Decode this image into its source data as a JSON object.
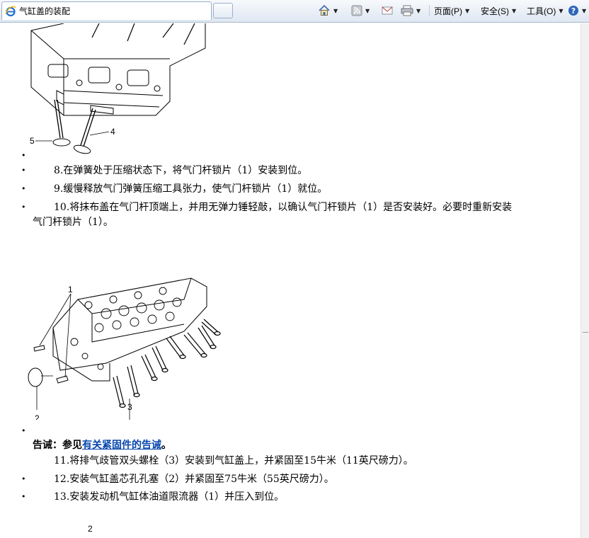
{
  "browser": {
    "tab_title": "气缸盖的装配",
    "commands": {
      "page_label": "页面(P)",
      "safety_label": "安全(S)",
      "tools_label": "工具(O)"
    }
  },
  "figure_top": {
    "callouts": [
      "5",
      "4"
    ]
  },
  "steps_a": [
    {
      "text": "8.在弹簧处于压缩状态下，将气门杆锁片（1）安装到位。"
    },
    {
      "text": "9.缓慢释放气门弹簧压缩工具张力，使气门杆锁片（1）就位。"
    },
    {
      "text": "10.将抹布盖在气门杆顶端上，并用无弹力锤轻敲，以确认气门杆锁片（1）是否安装好。必要时重新安装",
      "cont": "气门杆锁片（1）。"
    }
  ],
  "figure_mid": {
    "callouts": [
      "1",
      "2",
      "3"
    ]
  },
  "warning": {
    "prefix": "告诫：参见",
    "link": "有关紧固件的告诫",
    "suffix": "。"
  },
  "steps_b": [
    {
      "text": "11.将排气歧管双头螺栓（3）安装到气缸盖上，并紧固至15牛米（11英尺磅力）。"
    },
    {
      "text": "12.安装气缸盖芯孔孔塞（2）并紧固至75牛米（55英尺磅力）。"
    },
    {
      "text": "13.安装发动机气缸体油道限流器（1）并压入到位。"
    }
  ],
  "figure_bottom": {
    "callouts": [
      "2"
    ]
  },
  "bullet_char": "•"
}
